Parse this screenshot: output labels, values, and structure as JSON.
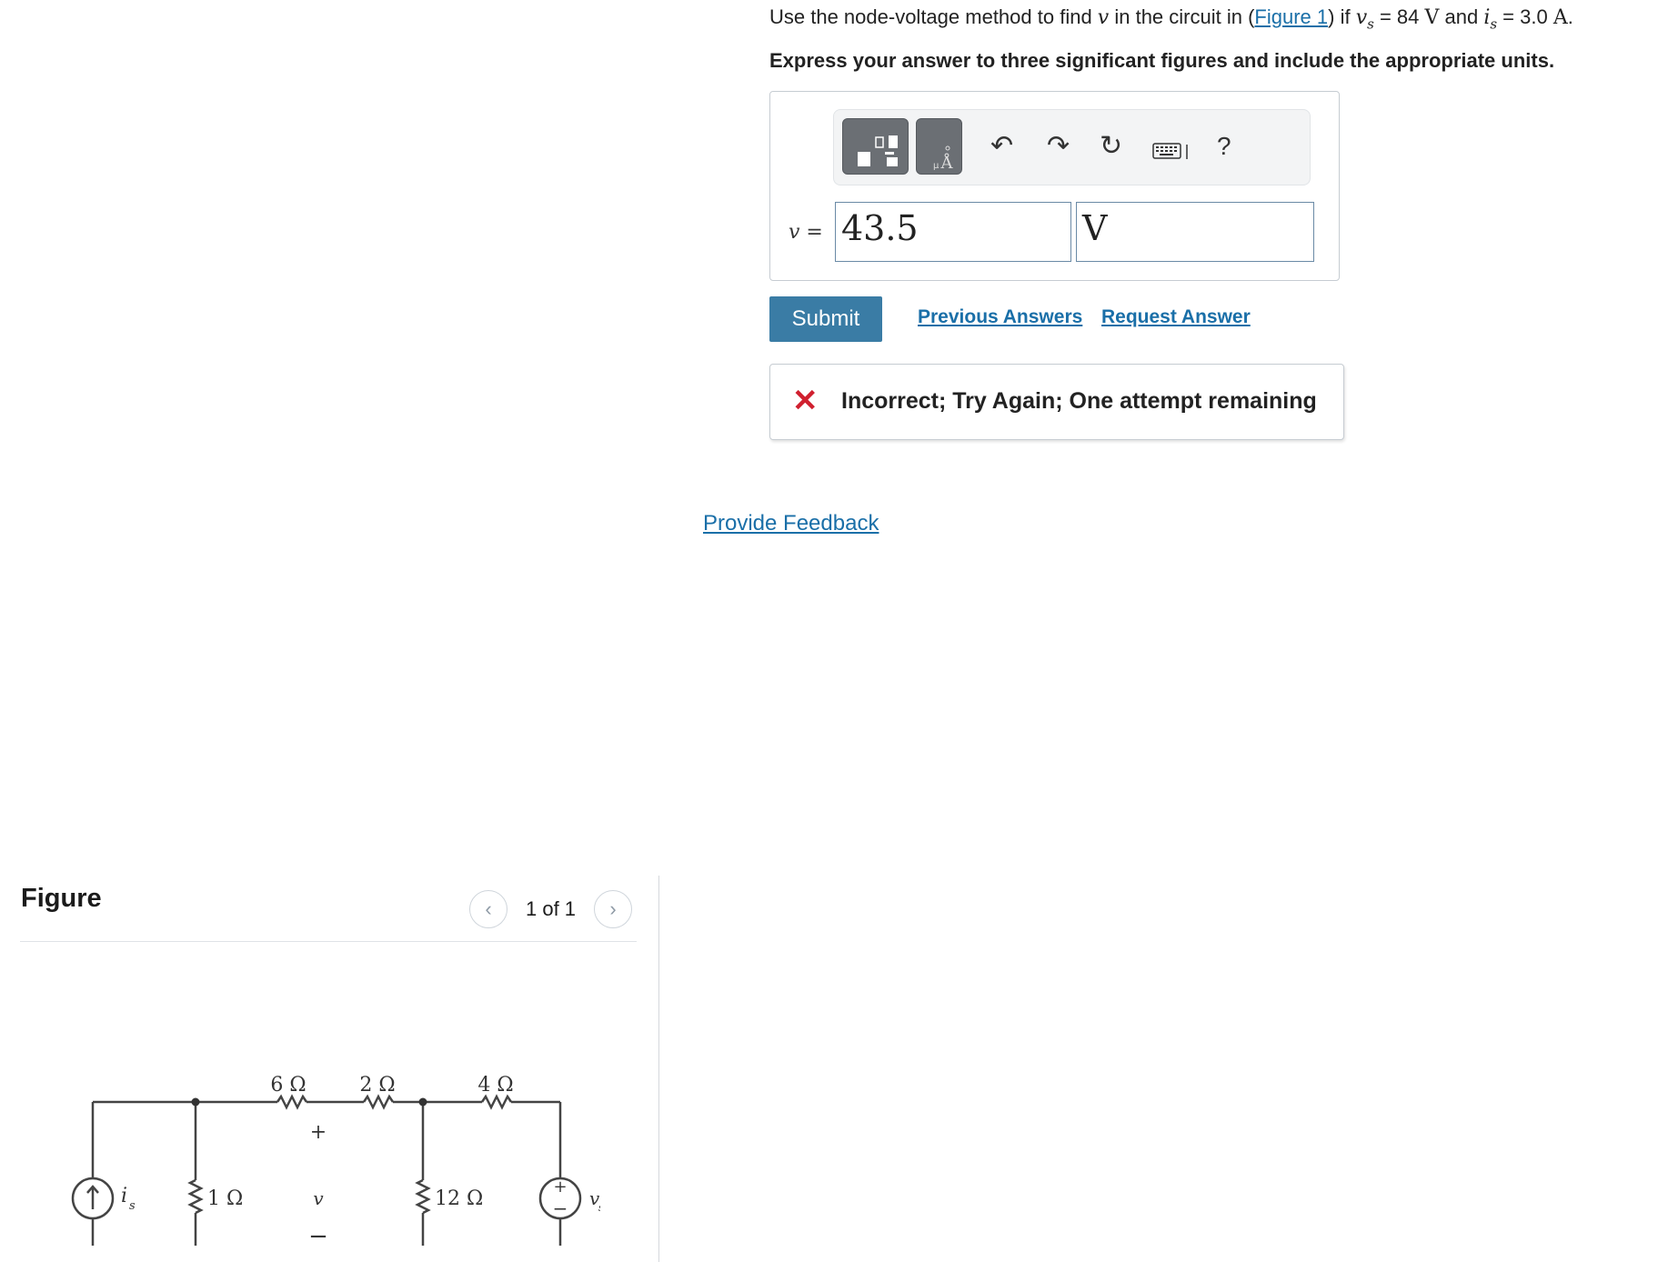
{
  "question": {
    "prefix": "Use the node-voltage method to find ",
    "var_v": "v",
    "mid1": " in the circuit in (",
    "figure_link": "Figure 1",
    "mid2": ") if ",
    "vs_var": "v",
    "vs_sub": "s",
    "vs_eq": " = 84 ",
    "vs_unit": "V",
    "and": " and ",
    "is_var": "i",
    "is_sub": "s",
    "is_eq": " = 3.0 ",
    "is_unit": "A",
    "end": "."
  },
  "instruction": "Express your answer to three significant figures and include the appropriate units.",
  "answer": {
    "var_label": "v =",
    "value": "43.5",
    "unit": "V"
  },
  "toolbar": {
    "icons": [
      "templates-icon",
      "units-icon",
      "undo-icon",
      "redo-icon",
      "reset-icon",
      "keyboard-icon",
      "help-icon"
    ],
    "help_label": "?"
  },
  "actions": {
    "submit": "Submit",
    "previous_answers": "Previous Answers",
    "request_answer": "Request Answer"
  },
  "feedback": {
    "message": "Incorrect; Try Again; One attempt remaining"
  },
  "provide_feedback": "Provide Feedback",
  "figure": {
    "title": "Figure",
    "pager_text": "1 of 1",
    "circuit": {
      "r1": "6 Ω",
      "r2": "2 Ω",
      "r3": "4 Ω",
      "r4": "1 Ω",
      "r5": "12 Ω",
      "plus": "+",
      "minus": "−",
      "v_label": "v",
      "is_label": "i",
      "is_sub": "s",
      "vs_label": "v",
      "vs_sub": "s",
      "src_plus": "+",
      "src_minus": "−"
    }
  }
}
